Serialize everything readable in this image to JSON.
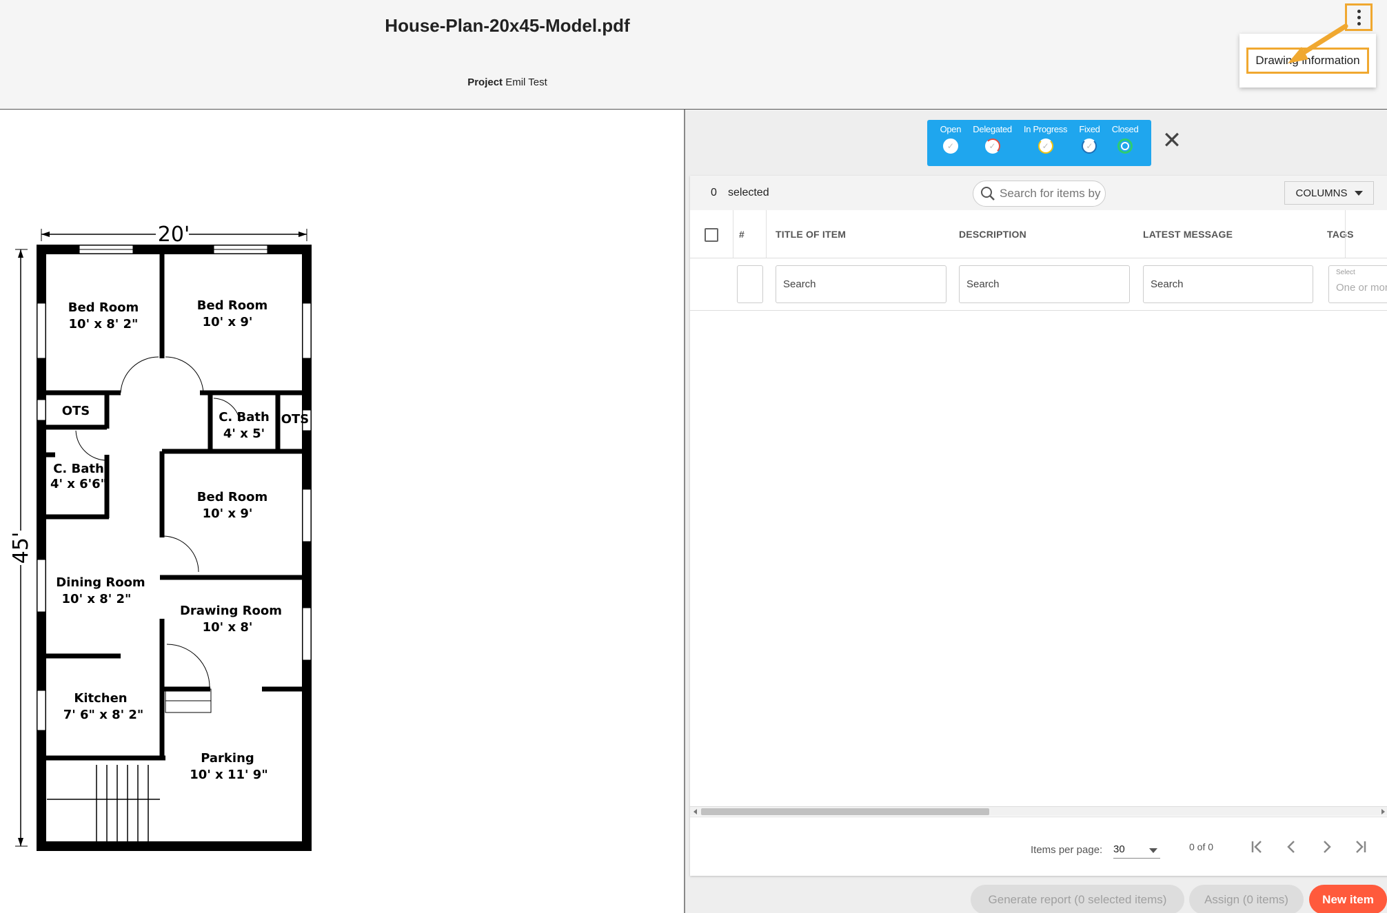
{
  "header": {
    "doc_title": "House-Plan-20x45-Model.pdf",
    "project_label": "Project",
    "project_name": "Emil Test",
    "menu_icon": "more-vertical-icon",
    "dropdown_item": "Drawing information",
    "highlight_color": "#f0a830"
  },
  "drawing": {
    "width_dim": "20'",
    "height_dim": "45'",
    "rooms": [
      {
        "name": "Bed Room",
        "size": "10' x 8' 2\""
      },
      {
        "name": "Bed Room",
        "size": "10' x 9'"
      },
      {
        "name": "OTS",
        "size": ""
      },
      {
        "name": "C. Bath",
        "size": "4' x 5'"
      },
      {
        "name": "OTS",
        "size": ""
      },
      {
        "name": "C. Bath",
        "size": "4' x 6'6\""
      },
      {
        "name": "Bed Room",
        "size": "10' x 9'"
      },
      {
        "name": "Dining Room",
        "size": "10' x 8' 2\""
      },
      {
        "name": "Drawing Room",
        "size": "10' x 8'"
      },
      {
        "name": "Kitchen",
        "size": "7' 6\" x 8' 2\""
      },
      {
        "name": "Parking",
        "size": "10'  x 11' 9\""
      }
    ]
  },
  "status_filter": {
    "color": "#1fa6ee",
    "items": [
      {
        "label": "Open",
        "ring": "#ffffff"
      },
      {
        "label": "Delegated",
        "ring": "#e74c3c"
      },
      {
        "label": "In Progress",
        "ring": "#f1c40f"
      },
      {
        "label": "Fixed",
        "ring": "#1f6fb5"
      },
      {
        "label": "Closed",
        "ring": "#2ecc71"
      }
    ],
    "close_icon": "close-icon"
  },
  "table": {
    "selected_count": "0",
    "selected_label": "selected",
    "search_placeholder": "Search for items by",
    "columns_label": "COLUMNS",
    "headers": {
      "number": "#",
      "title": "TITLE OF ITEM",
      "description": "DESCRIPTION",
      "latest_message": "LATEST MESSAGE",
      "tags": "TAGS"
    },
    "filters": {
      "title_placeholder": "Search",
      "description_placeholder": "Search",
      "message_placeholder": "Search",
      "tags_label": "Select",
      "tags_placeholder": "One or more"
    }
  },
  "pager": {
    "items_per_page_label": "Items per page:",
    "items_per_page": "30",
    "range": "0 of 0"
  },
  "actions": {
    "generate_report": "Generate report (0 selected items)",
    "assign": "Assign (0 items)",
    "new_item": "New item",
    "new_item_color": "#ff5a3c"
  }
}
